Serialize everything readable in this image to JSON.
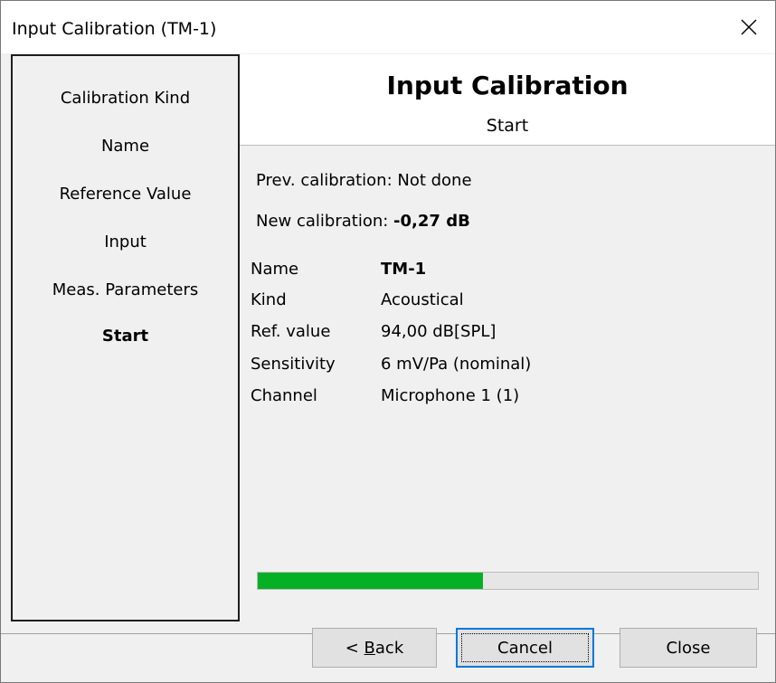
{
  "window": {
    "title": "Input Calibration (TM-1)",
    "close_icon": "close-icon"
  },
  "sidebar": {
    "steps": [
      {
        "label": "Calibration Kind",
        "active": false
      },
      {
        "label": "Name",
        "active": false
      },
      {
        "label": "Reference Value",
        "active": false
      },
      {
        "label": "Input",
        "active": false
      },
      {
        "label": "Meas. Parameters",
        "active": false
      },
      {
        "label": "Start",
        "active": true
      }
    ]
  },
  "header": {
    "title": "Input Calibration",
    "subtitle": "Start"
  },
  "content": {
    "prev_calibration": "Prev. calibration: Not done",
    "new_calibration_label": "New calibration: ",
    "new_calibration_value": "-0,27 dB",
    "details": [
      {
        "label": "Name",
        "value": "TM-1",
        "bold": true
      },
      {
        "label": "Kind",
        "value": "Acoustical",
        "bold": false
      },
      {
        "label": "Ref. value",
        "value": "94,00 dB[SPL]",
        "bold": false
      },
      {
        "label": "Sensitivity",
        "value": "6 mV/Pa (nominal)",
        "bold": false
      },
      {
        "label": "Channel",
        "value": "Microphone 1 (1)",
        "bold": false
      }
    ]
  },
  "progress": {
    "fraction": 0.45,
    "color": "#06b025"
  },
  "buttons": {
    "back_underlined_letter": "B",
    "back_prefix": "< ",
    "back_rest": "ack",
    "cancel": "Cancel",
    "close": "Close"
  }
}
